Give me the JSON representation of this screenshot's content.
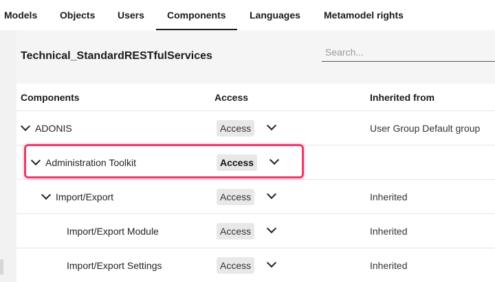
{
  "tabs": [
    {
      "label": "Models",
      "active": false
    },
    {
      "label": "Objects",
      "active": false
    },
    {
      "label": "Users",
      "active": false
    },
    {
      "label": "Components",
      "active": true
    },
    {
      "label": "Languages",
      "active": false
    },
    {
      "label": "Metamodel rights",
      "active": false
    }
  ],
  "page_title": "Technical_StandardRESTfulServices",
  "search": {
    "placeholder": "Search...",
    "value": ""
  },
  "table": {
    "headers": {
      "components": "Components",
      "access": "Access",
      "inherited_from": "Inherited from"
    },
    "rows": [
      {
        "name": "ADONIS",
        "expanded": true,
        "access": "Access",
        "inherited_from": "User Group Default group"
      },
      {
        "name": "Administration Toolkit",
        "expanded": true,
        "access": "Access",
        "inherited_from": ""
      },
      {
        "name": "Import/Export",
        "expanded": true,
        "access": "Access",
        "inherited_from": "Inherited"
      },
      {
        "name": "Import/Export Module",
        "expanded": false,
        "access": "Access",
        "inherited_from": "Inherited"
      },
      {
        "name": "Import/Export Settings",
        "expanded": false,
        "access": "Access",
        "inherited_from": "Inherited"
      }
    ]
  },
  "colors": {
    "highlight": "#ee3a6a",
    "badge_bg": "#e8e8e8",
    "panel_bg": "#f5f5f5"
  }
}
